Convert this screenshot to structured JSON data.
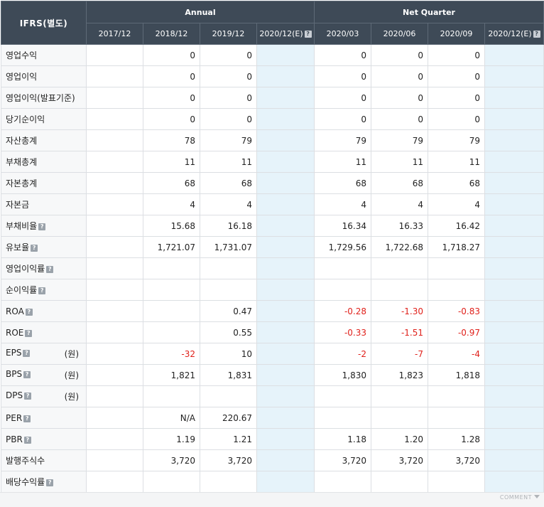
{
  "header": {
    "corner": "IFRS(별도)",
    "annual_label": "Annual",
    "quarter_label": "Net Quarter",
    "periods": [
      "2017/12",
      "2018/12",
      "2019/12",
      "2020/12(E)",
      "2020/03",
      "2020/06",
      "2020/09",
      "2020/12(E)"
    ]
  },
  "rows": [
    {
      "label": "영업수익",
      "help": false,
      "unit": "",
      "values": [
        "",
        "0",
        "0",
        "",
        "0",
        "0",
        "0",
        ""
      ]
    },
    {
      "label": "영업이익",
      "help": false,
      "unit": "",
      "values": [
        "",
        "0",
        "0",
        "",
        "0",
        "0",
        "0",
        ""
      ]
    },
    {
      "label": "영업이익(발표기준)",
      "help": false,
      "unit": "",
      "values": [
        "",
        "0",
        "0",
        "",
        "0",
        "0",
        "0",
        ""
      ]
    },
    {
      "label": "당기순이익",
      "help": false,
      "unit": "",
      "values": [
        "",
        "0",
        "0",
        "",
        "0",
        "0",
        "0",
        ""
      ]
    },
    {
      "label": "자산총계",
      "help": false,
      "unit": "",
      "values": [
        "",
        "78",
        "79",
        "",
        "79",
        "79",
        "79",
        ""
      ]
    },
    {
      "label": "부채총계",
      "help": false,
      "unit": "",
      "values": [
        "",
        "11",
        "11",
        "",
        "11",
        "11",
        "11",
        ""
      ]
    },
    {
      "label": "자본총계",
      "help": false,
      "unit": "",
      "values": [
        "",
        "68",
        "68",
        "",
        "68",
        "68",
        "68",
        ""
      ]
    },
    {
      "label": "자본금",
      "help": false,
      "unit": "",
      "values": [
        "",
        "4",
        "4",
        "",
        "4",
        "4",
        "4",
        ""
      ]
    },
    {
      "label": "부채비율",
      "help": true,
      "unit": "",
      "values": [
        "",
        "15.68",
        "16.18",
        "",
        "16.34",
        "16.33",
        "16.42",
        ""
      ]
    },
    {
      "label": "유보율",
      "help": true,
      "unit": "",
      "values": [
        "",
        "1,721.07",
        "1,731.07",
        "",
        "1,729.56",
        "1,722.68",
        "1,718.27",
        ""
      ]
    },
    {
      "label": "영업이익률",
      "help": true,
      "unit": "",
      "values": [
        "",
        "",
        "",
        "",
        "",
        "",
        "",
        ""
      ]
    },
    {
      "label": "순이익률",
      "help": true,
      "unit": "",
      "values": [
        "",
        "",
        "",
        "",
        "",
        "",
        "",
        ""
      ]
    },
    {
      "label": "ROA",
      "help": true,
      "unit": "",
      "values": [
        "",
        "",
        "0.47",
        "",
        "-0.28",
        "-1.30",
        "-0.83",
        ""
      ]
    },
    {
      "label": "ROE",
      "help": true,
      "unit": "",
      "values": [
        "",
        "",
        "0.55",
        "",
        "-0.33",
        "-1.51",
        "-0.97",
        ""
      ]
    },
    {
      "label": "EPS",
      "help": true,
      "unit": "(원)",
      "values": [
        "",
        "-32",
        "10",
        "",
        "-2",
        "-7",
        "-4",
        ""
      ]
    },
    {
      "label": "BPS",
      "help": true,
      "unit": "(원)",
      "values": [
        "",
        "1,821",
        "1,831",
        "",
        "1,830",
        "1,823",
        "1,818",
        ""
      ]
    },
    {
      "label": "DPS",
      "help": true,
      "unit": "(원)",
      "values": [
        "",
        "",
        "",
        "",
        "",
        "",
        "",
        ""
      ]
    },
    {
      "label": "PER",
      "help": true,
      "unit": "",
      "values": [
        "",
        "N/A",
        "220.67",
        "",
        "",
        "",
        "",
        ""
      ]
    },
    {
      "label": "PBR",
      "help": true,
      "unit": "",
      "values": [
        "",
        "1.19",
        "1.21",
        "",
        "1.18",
        "1.20",
        "1.28",
        ""
      ]
    },
    {
      "label": "발행주식수",
      "help": false,
      "unit": "",
      "values": [
        "",
        "3,720",
        "3,720",
        "",
        "3,720",
        "3,720",
        "3,720",
        ""
      ]
    },
    {
      "label": "배당수익률",
      "help": true,
      "unit": "",
      "values": [
        "",
        "",
        "",
        "",
        "",
        "",
        "",
        ""
      ]
    }
  ],
  "help_glyph": "?",
  "footer": {
    "comment_label": "COMMENT"
  },
  "colors": {
    "header_bg": "#3e4a57",
    "estimate_bg": "#e6f3fa",
    "negative": "#e0211b"
  }
}
